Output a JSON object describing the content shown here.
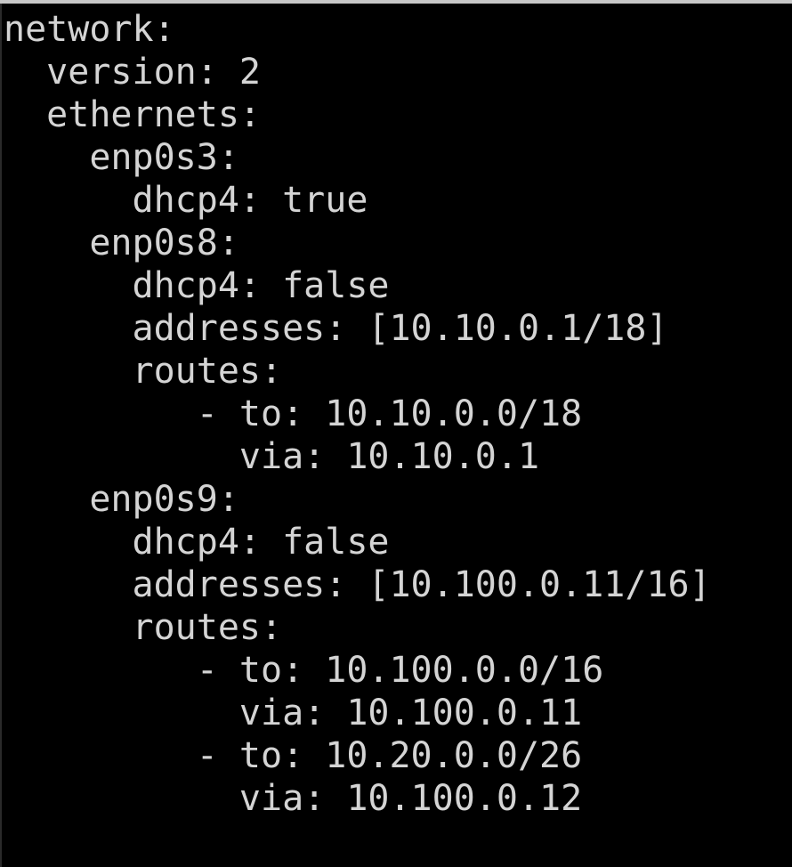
{
  "terminal": {
    "lines": [
      "network:",
      "  version: 2",
      "  ethernets:",
      "    enp0s3:",
      "      dhcp4: true",
      "    enp0s8:",
      "      dhcp4: false",
      "      addresses: [10.10.0.1/18]",
      "      routes:",
      "         - to: 10.10.0.0/18",
      "           via: 10.10.0.1",
      "    enp0s9:",
      "      dhcp4: false",
      "      addresses: [10.100.0.11/16]",
      "      routes:",
      "         - to: 10.100.0.0/16",
      "           via: 10.100.0.11",
      "         - to: 10.20.0.0/26",
      "           via: 10.100.0.12"
    ]
  },
  "colors": {
    "background": "#000000",
    "text": "#d4d4d4"
  }
}
